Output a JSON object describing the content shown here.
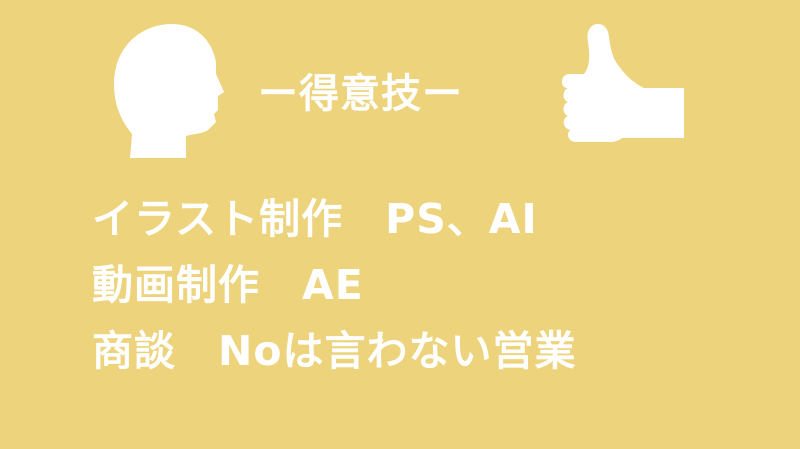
{
  "heading": "ー得意技ー",
  "skills": [
    "イラスト制作　PS、AI",
    "動画制作　AE",
    "商談　Noは言わない営業"
  ],
  "icons": {
    "left": "head-silhouette-icon",
    "right": "thumbs-up-icon"
  },
  "colors": {
    "background": "#ecd37c",
    "foreground": "#ffffff"
  }
}
